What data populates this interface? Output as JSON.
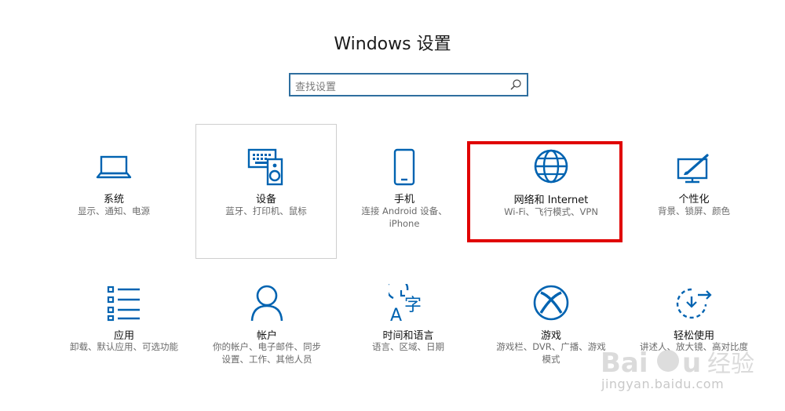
{
  "window": {
    "title": "Windows 设置"
  },
  "search": {
    "placeholder": "查找设置"
  },
  "tiles": [
    {
      "name": "系统",
      "desc": "显示、通知、电源",
      "icon": "laptop-icon"
    },
    {
      "name": "设备",
      "desc": "蓝牙、打印机、鼠标",
      "icon": "devices-icon"
    },
    {
      "name": "手机",
      "desc": "连接 Android 设备、",
      "desc2": "iPhone",
      "icon": "phone-icon"
    },
    {
      "name": "网络和 Internet",
      "desc": "Wi-Fi、飞行模式、VPN",
      "icon": "globe-icon"
    },
    {
      "name": "个性化",
      "desc": "背景、锁屏、颜色",
      "icon": "personalization-icon"
    },
    {
      "name": "应用",
      "desc": "卸载、默认应用、可选功能",
      "icon": "apps-list-icon"
    },
    {
      "name": "帐户",
      "desc": "你的帐户、电子邮件、同步",
      "desc2": "设置、工作、其他人员",
      "icon": "person-icon"
    },
    {
      "name": "时间和语言",
      "desc": "语言、区域、日期",
      "icon": "time-language-icon"
    },
    {
      "name": "游戏",
      "desc": "游戏栏、DVR、广播、游戏",
      "desc2": "模式",
      "icon": "xbox-icon"
    },
    {
      "name": "轻松使用",
      "desc": "讲述人、放大镜、高对比度",
      "icon": "ease-of-access-icon"
    }
  ],
  "watermark": {
    "brand": "Baidu 经验",
    "url": "jingyan.baidu.com"
  },
  "colors": {
    "accent": "#0063b1",
    "highlight": "#e00000",
    "search_border": "#2f6f9f"
  }
}
